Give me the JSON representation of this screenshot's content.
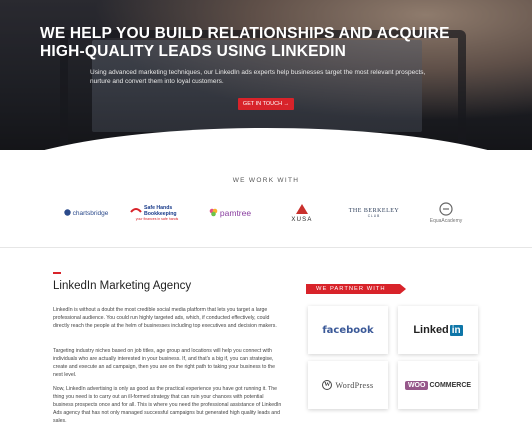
{
  "hero": {
    "title": "WE HELP YOU BUILD RELATIONSHIPS AND ACQUIRE HIGH-QUALITY LEADS USING LINKEDIN",
    "subtitle": "Using advanced marketing techniques, our LinkedIn ads experts help businesses target the most relevant prospects, nurture and convert them into loyal customers.",
    "cta_label": "GET IN TOUCH →"
  },
  "clients": {
    "title": "WE WORK WITH",
    "logos": [
      {
        "name": "chartsbridge",
        "text": "chartsbridge"
      },
      {
        "name": "safe-hands",
        "text": "Safe Hands Bookkeeping",
        "tagline": "your finances in safe hands"
      },
      {
        "name": "pamtree",
        "text": "pamtree"
      },
      {
        "name": "xusa",
        "text": "XUSA"
      },
      {
        "name": "the-berkeley",
        "text": "THE BERKELEY",
        "tagline": "CLUB"
      },
      {
        "name": "equa-academy",
        "text": "EquaAcademy"
      }
    ]
  },
  "agency": {
    "heading": "LinkedIn Marketing Agency",
    "paragraphs": [
      "LinkedIn is without a doubt the most credible social media platform that lets you target a large professional audience. You could run highly targeted ads, which, if conducted effectively, could directly reach the people at the helm of businesses including top executives and decision makers.",
      "Targeting industry niches based on job titles, age group and locations will help you connect with individuals who are actually interested in your business. If, and that's a big if, you can strategise, create and execute an ad campaign, then you are on the right path to taking your business to the next level.",
      "Now, LinkedIn advertising is only as good as the practical experience you have got running it. The thing you need is to carry out an ill-formed strategy that can ruin your chances with potential business prospects once and for all. This is where you need the professional assistance of LinkedIn Ads agency that has not only managed successful campaigns but generated high quality leads and sales."
    ]
  },
  "partners": {
    "title": "WE PARTNER WITH",
    "facebook": "facebook",
    "linkedin_a": "Linked",
    "linkedin_b": "in",
    "wordpress": "WordPress",
    "woo_a": "WOO",
    "woo_b": "COMMERCE"
  },
  "colors": {
    "accent": "#d8232a",
    "facebook": "#3b5998",
    "linkedin": "#0e76a8",
    "woo": "#96588a"
  }
}
